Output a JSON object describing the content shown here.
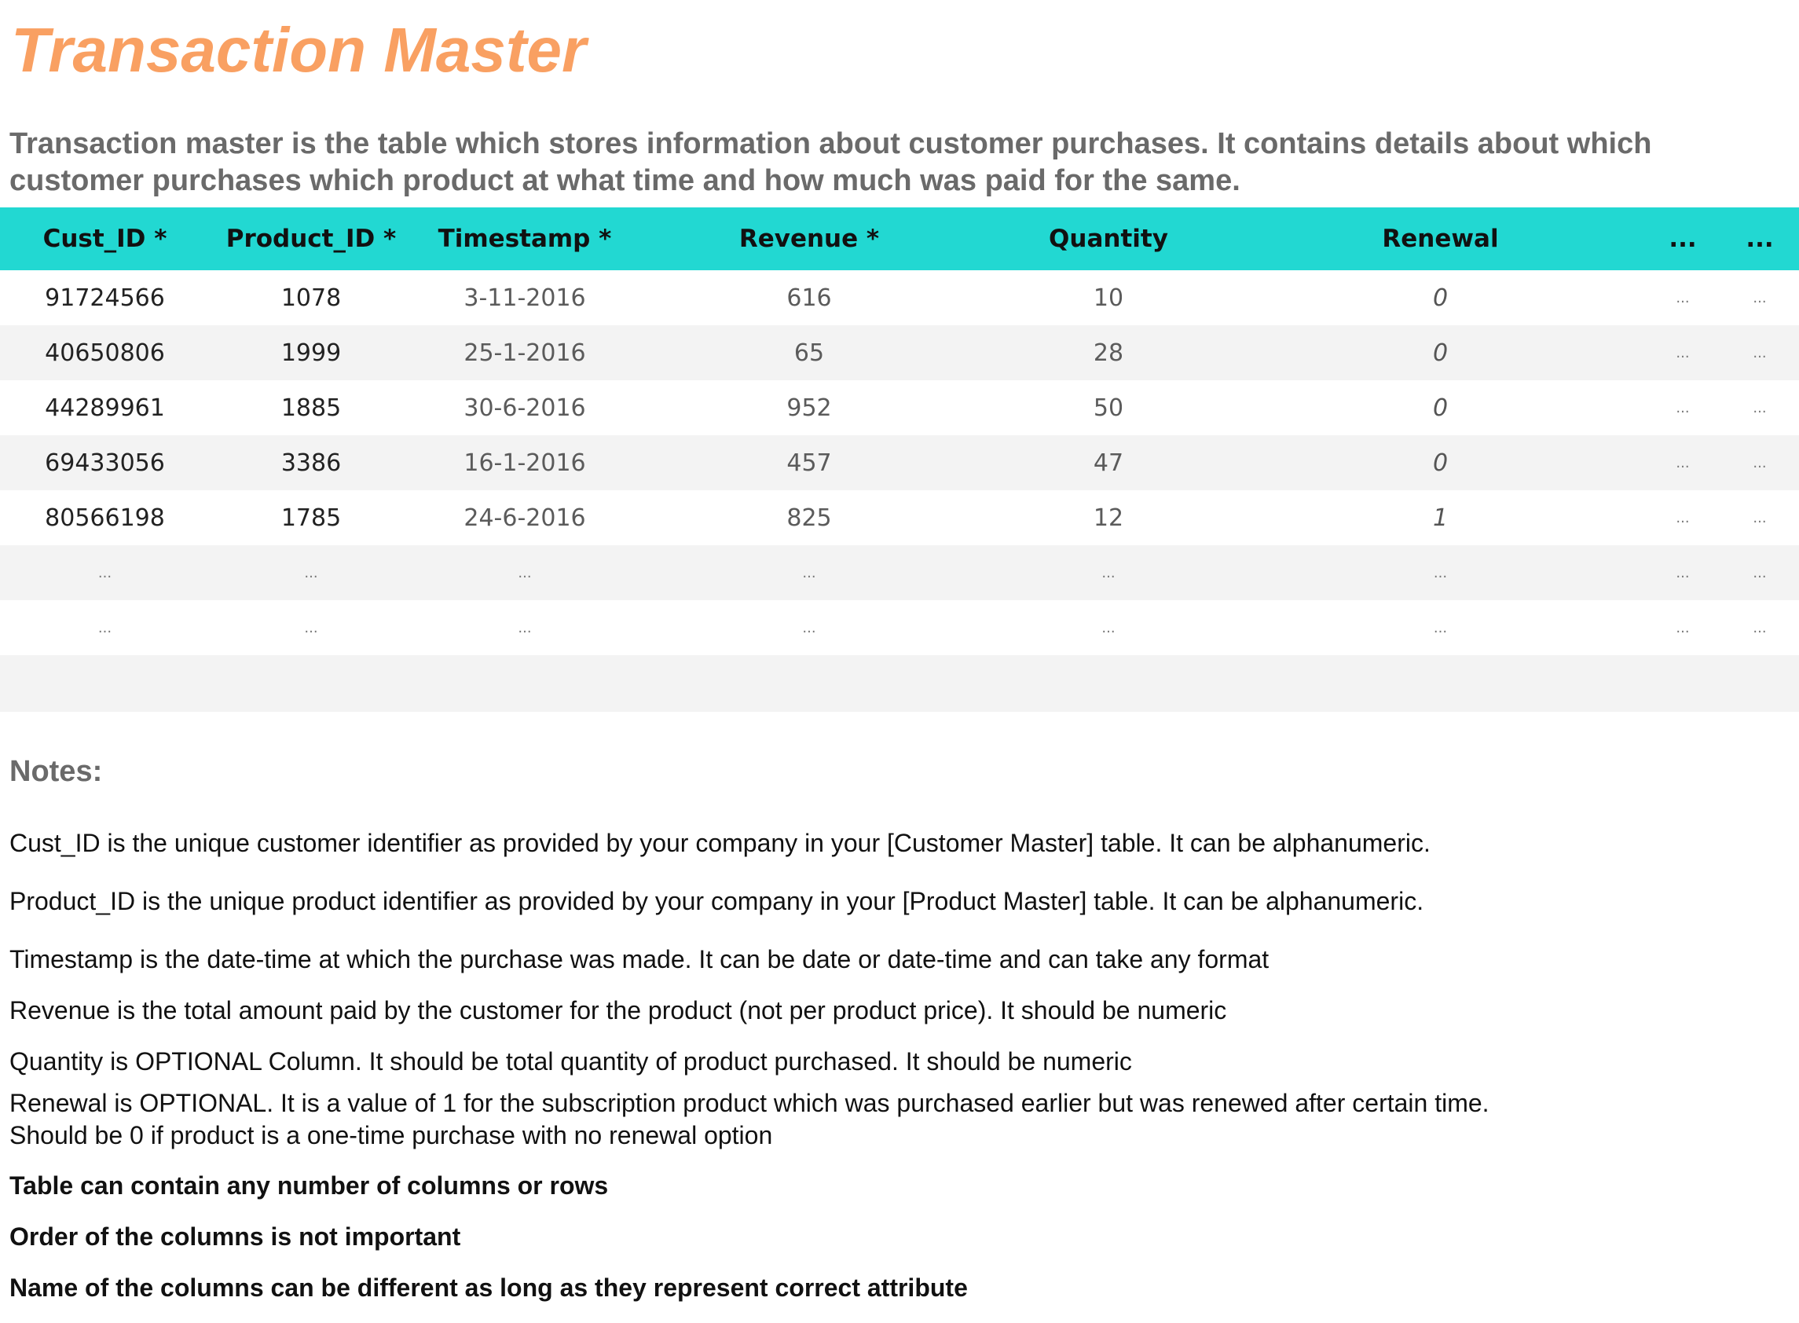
{
  "page": {
    "title": "Transaction Master",
    "intro": "Transaction master is the table which stores information about customer purchases. It contains details about which customer purchases which product at what time and how much was paid for the same."
  },
  "table": {
    "columns": [
      "Cust_ID *",
      "Product_ID *",
      "Timestamp *",
      "Revenue *",
      "Quantity",
      "Renewal",
      "...",
      "..."
    ],
    "rows": [
      [
        "91724566",
        "1078",
        "3-11-2016",
        "616",
        "10",
        "0",
        "...",
        "..."
      ],
      [
        "40650806",
        "1999",
        "25-1-2016",
        "65",
        "28",
        "0",
        "...",
        "..."
      ],
      [
        "44289961",
        "1885",
        "30-6-2016",
        "952",
        "50",
        "0",
        "...",
        "..."
      ],
      [
        "69433056",
        "3386",
        "16-1-2016",
        "457",
        "47",
        "0",
        "...",
        "..."
      ],
      [
        "80566198",
        "1785",
        "24-6-2016",
        "825",
        "12",
        "1",
        "...",
        "..."
      ],
      [
        "...",
        "...",
        "...",
        "...",
        "...",
        "...",
        "...",
        "..."
      ],
      [
        "...",
        "...",
        "...",
        "...",
        "...",
        "...",
        "...",
        "..."
      ]
    ]
  },
  "notes": {
    "heading": "Notes:",
    "items": [
      "Cust_ID is the unique customer identifier as provided by your company in your [Customer Master] table. It can be alphanumeric.",
      "Product_ID is the unique product identifier as provided by your company in your [Product Master] table. It can be alphanumeric.",
      "Timestamp is the date-time at which the purchase was made. It can be date or date-time and can take any format",
      "Revenue is the total amount paid by the customer for the product (not per product price). It should be numeric",
      "Quantity is OPTIONAL Column. It should be total quantity of product purchased. It should be numeric",
      "Renewal is OPTIONAL. It is a value of 1 for the subscription product which was purchased earlier but was renewed after certain time.",
      "Should be 0 if product is a one-time purchase with no renewal option",
      "Table can contain any number of columns or rows",
      "Order of the columns is not important",
      "Name of the columns can be different as long as they represent correct attribute"
    ]
  },
  "colors": {
    "title": "#f9a062",
    "header_bg": "#22d8d2",
    "row_alt_bg": "#f3f3f3",
    "heading_gray": "#6a6a6a"
  }
}
